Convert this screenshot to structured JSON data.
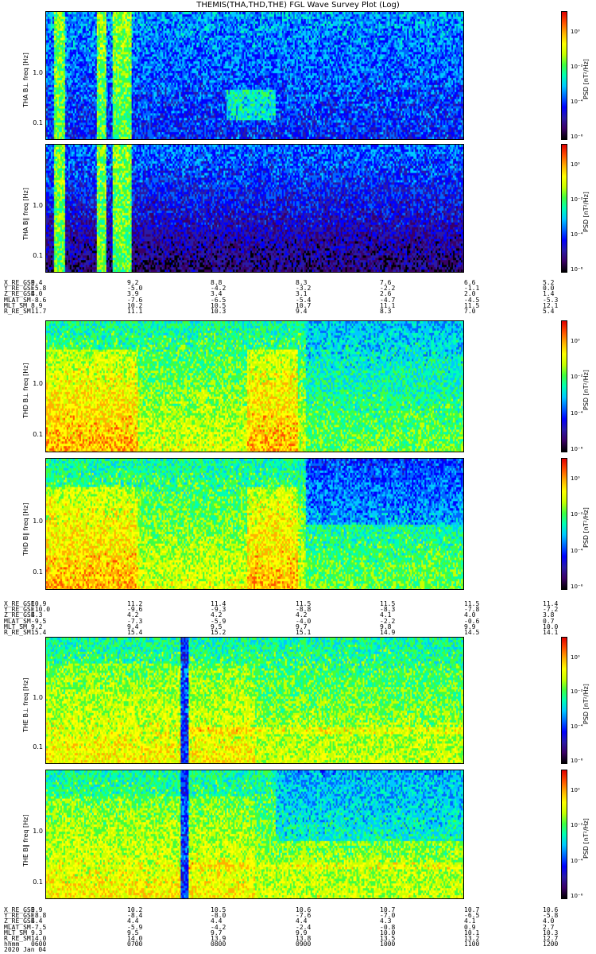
{
  "title": "THEMIS(THA,THD,THE) FGL Wave Survey Plot (Log)",
  "colors": {
    "cmap": [
      "#000000",
      "#3a0066",
      "#2a1aa8",
      "#0000ff",
      "#0066ff",
      "#00c8ff",
      "#00ffb4",
      "#40ff40",
      "#c8ff00",
      "#ffff00",
      "#ffb000",
      "#ff5000",
      "#e00000"
    ]
  },
  "chart_data": [
    {
      "type": "heatmap",
      "panel": "THA BL",
      "ylabel": "THA B⊥",
      "yunit": "freq [Hz]",
      "yticks": [
        "1.0",
        "0.1"
      ],
      "cbar_label": "PSD [nT²/Hz]",
      "cbar_ticks": [
        "10⁰",
        "10⁻²",
        "10⁻⁴",
        "10⁻⁶"
      ],
      "scale": "log"
    },
    {
      "type": "heatmap",
      "panel": "THA Bll",
      "ylabel": "THA B∥",
      "yunit": "freq [Hz]",
      "yticks": [
        "1.0",
        "0.1"
      ],
      "cbar_label": "PSD [nT²/Hz]",
      "cbar_ticks": [
        "10⁰",
        "10⁻²",
        "10⁻⁴",
        "10⁻⁶"
      ],
      "scale": "log"
    },
    {
      "type": "heatmap",
      "panel": "THD BL",
      "ylabel": "THD B⊥",
      "yunit": "freq [Hz]",
      "yticks": [
        "1.0",
        "0.1"
      ],
      "cbar_label": "PSD [nT²/Hz]",
      "cbar_ticks": [
        "10⁰",
        "10⁻²",
        "10⁻⁴",
        "10⁻⁶"
      ],
      "scale": "log"
    },
    {
      "type": "heatmap",
      "panel": "THD Bll",
      "ylabel": "THD B∥",
      "yunit": "freq [Hz]",
      "yticks": [
        "1.0",
        "0.1"
      ],
      "cbar_label": "PSD [nT²/Hz]",
      "cbar_ticks": [
        "10⁰",
        "10⁻²",
        "10⁻⁴",
        "10⁻⁶"
      ],
      "scale": "log"
    },
    {
      "type": "heatmap",
      "panel": "THE BL",
      "ylabel": "THE B⊥",
      "yunit": "freq [Hz]",
      "yticks": [
        "1.0",
        "0.1"
      ],
      "cbar_label": "PSD [nT²/Hz]",
      "cbar_ticks": [
        "10⁰",
        "10⁻²",
        "10⁻⁴",
        "10⁻⁶"
      ],
      "scale": "log"
    },
    {
      "type": "heatmap",
      "panel": "THE Bll",
      "ylabel": "THE B∥",
      "yunit": "freq [Hz]",
      "yticks": [
        "1.0",
        "0.1"
      ],
      "cbar_label": "PSD [nT²/Hz]",
      "cbar_ticks": [
        "10⁰",
        "10⁻²",
        "10⁻⁴",
        "10⁻⁶"
      ],
      "scale": "log"
    }
  ],
  "ephem": [
    {
      "probe": "THA",
      "labels": [
        "X_RE_GSE",
        "Y_RE_GSE",
        "Z_RE_GSE",
        "MLAT_SM",
        "MLT_SM",
        "R_RE_SM"
      ],
      "columns": [
        [
          "9.4",
          "-5.8",
          "4.0",
          "-8.6",
          "8.9",
          "11.7"
        ],
        [
          "9.2",
          "-5.0",
          "3.9",
          "-7.6",
          "10.2",
          "11.1"
        ],
        [
          "8.8",
          "-4.2",
          "3.4",
          "-6.5",
          "10.5",
          "10.3"
        ],
        [
          "8.3",
          "-3.2",
          "3.1",
          "-5.4",
          "10.7",
          "9.4"
        ],
        [
          "7.6",
          "-2.2",
          "2.6",
          "-4.7",
          "11.1",
          "8.3"
        ],
        [
          "6.6",
          "-1.1",
          "2.0",
          "-4.5",
          "11.5",
          "7.0"
        ],
        [
          "5.2",
          "0.0",
          "1.4",
          "-5.3",
          "12.1",
          "5.4"
        ]
      ]
    },
    {
      "probe": "THD",
      "labels": [
        "X_RE_GSE",
        "Y_RE_GSE",
        "Z_RE_GSE",
        "MLAT_SM",
        "MLT_SM",
        "R_RE_SM"
      ],
      "columns": [
        [
          "10.9",
          "-10.0",
          "4.3",
          "-9.5",
          "9.2",
          "15.4"
        ],
        [
          "11.2",
          "-9.6",
          "4.2",
          "-7.3",
          "9.4",
          "15.4"
        ],
        [
          "11.4",
          "-9.3",
          "4.2",
          "-5.9",
          "9.5",
          "15.2"
        ],
        [
          "11.5",
          "-8.8",
          "4.2",
          "-4.0",
          "9.7",
          "15.1"
        ],
        [
          "11.5",
          "-8.3",
          "4.1",
          "-2.2",
          "9.8",
          "14.9"
        ],
        [
          "11.5",
          "-7.8",
          "4.0",
          "-0.6",
          "9.9",
          "14.5"
        ],
        [
          "11.4",
          "-7.2",
          "3.8",
          "0.7",
          "10.0",
          "14.1"
        ]
      ]
    },
    {
      "probe": "THE",
      "labels": [
        "X_RE_GSE",
        "Y_RE_GSE",
        "Z_RE_GSE",
        "MLAT_SM",
        "MLT_SM",
        "R_RE_SM",
        "hhmm",
        "2020 Jan 04"
      ],
      "columns": [
        [
          "9.9",
          "-8.8",
          "4.4",
          "-7.5",
          "9.3",
          "14.0",
          "0600"
        ],
        [
          "10.2",
          "-8.4",
          "4.4",
          "-5.9",
          "9.5",
          "14.0",
          "0700"
        ],
        [
          "10.5",
          "-8.0",
          "4.4",
          "-4.2",
          "9.7",
          "13.9",
          "0800"
        ],
        [
          "10.6",
          "-7.6",
          "4.4",
          "-2.4",
          "9.9",
          "13.8",
          "0900"
        ],
        [
          "10.7",
          "-7.0",
          "4.3",
          "-0.8",
          "10.0",
          "13.5",
          "1000"
        ],
        [
          "10.7",
          "-6.5",
          "4.1",
          "0.9",
          "10.1",
          "13.2",
          "1100"
        ],
        [
          "10.6",
          "-5.8",
          "4.0",
          "2.7",
          "10.3",
          "12.7",
          "1200"
        ]
      ]
    }
  ]
}
